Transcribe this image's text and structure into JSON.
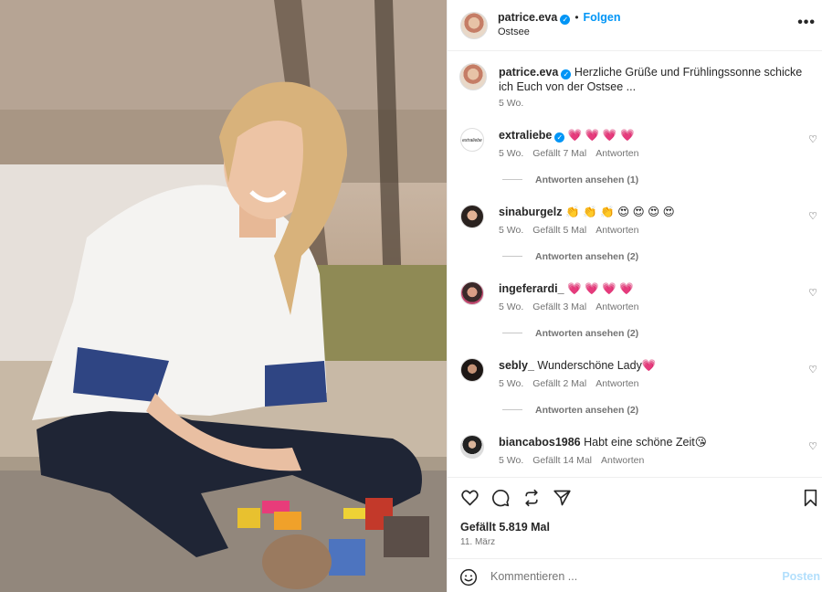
{
  "post": {
    "author": "patrice.eva",
    "follow_label": "Folgen",
    "location": "Ostsee",
    "more_label": "•••",
    "caption_text": "Herzliche Grüße und Frühlingssonne schicke ich Euch von der Ostsee ...",
    "caption_time": "5 Wo."
  },
  "comments": [
    {
      "user": "extraliebe",
      "verified": true,
      "text": "💗 💗 💗 💗",
      "time": "5 Wo.",
      "likes": "Gefällt 7 Mal",
      "reply": "Antworten",
      "view_replies": "Antworten ansehen (1)",
      "avatar_text": "extraliebe"
    },
    {
      "user": "sinaburgelz",
      "verified": false,
      "text": "👏 👏 👏 😍 😍 😍 😍",
      "time": "5 Wo.",
      "likes": "Gefällt 5 Mal",
      "reply": "Antworten",
      "view_replies": "Antworten ansehen (2)"
    },
    {
      "user": "ingeferardi_",
      "verified": false,
      "text": "💗 💗 💗 💗",
      "time": "5 Wo.",
      "likes": "Gefällt 3 Mal",
      "reply": "Antworten",
      "view_replies": "Antworten ansehen (2)"
    },
    {
      "user": "sebly_",
      "verified": false,
      "text": "Wunderschöne Lady💗",
      "time": "5 Wo.",
      "likes": "Gefällt 2 Mal",
      "reply": "Antworten",
      "view_replies": "Antworten ansehen (2)"
    },
    {
      "user": "biancabos1986",
      "verified": false,
      "text": "Habt eine schöne Zeit😘",
      "time": "5 Wo.",
      "likes": "Gefällt 14 Mal",
      "reply": "Antworten"
    }
  ],
  "footer": {
    "likes": "Gefällt 5.819 Mal",
    "date": "11. März",
    "comment_placeholder": "Kommentieren ...",
    "post_label": "Posten"
  },
  "colors": {
    "link": "#0095f6",
    "muted": "#737373",
    "post_disabled": "#b2dffc"
  },
  "icons": [
    "heart-icon",
    "comment-icon",
    "share-icon",
    "send-icon",
    "bookmark-icon",
    "smile-icon",
    "verified-icon",
    "more-icon"
  ]
}
